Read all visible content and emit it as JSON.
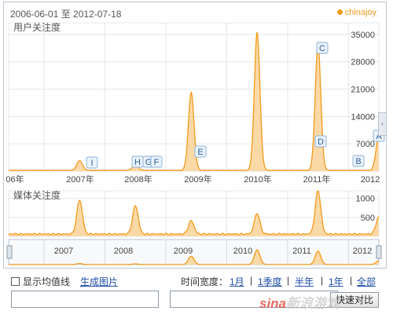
{
  "header": {
    "date_range": "2006-06-01 至 2012-07-18",
    "brand": "chinajoy"
  },
  "colors": {
    "line": "#f29a1c",
    "fill": "#fbd9a6",
    "marker_border": "#8fb3d9",
    "marker_bg": "#eaf2fb",
    "grid": "#e3e7ec"
  },
  "chart_data": [
    {
      "type": "area",
      "title": "用户关注度",
      "x_ticks": [
        "06年",
        "2007年",
        "2008年",
        "2009年",
        "2010年",
        "2011年",
        "2012"
      ],
      "y_ticks": [
        7000,
        14000,
        21000,
        28000,
        35000
      ],
      "ylim": [
        0,
        38000
      ],
      "peaks": [
        {
          "x": "2007-08",
          "y": 2500
        },
        {
          "x": "2008-07",
          "y": 1500
        },
        {
          "x": "2009-06",
          "y": 20000
        },
        {
          "x": "2010-07",
          "y": 35500
        },
        {
          "x": "2011-07",
          "y": 32500
        },
        {
          "x": "2012-07",
          "y": 9000
        }
      ],
      "markers": [
        {
          "label": "I",
          "x": "2007-09"
        },
        {
          "label": "H",
          "x": "2008-06"
        },
        {
          "label": "G",
          "x": "2008-08"
        },
        {
          "label": "F",
          "x": "2008-09"
        },
        {
          "label": "E",
          "x": "2009-06"
        },
        {
          "label": "D",
          "x": "2011-07"
        },
        {
          "label": "C",
          "x": "2011-07"
        },
        {
          "label": "B",
          "x": "2012-05"
        },
        {
          "label": "A",
          "x": "2012-07"
        }
      ]
    },
    {
      "type": "area",
      "title": "媒体关注度",
      "y_ticks": [
        500,
        1000
      ],
      "ylim": [
        0,
        1200
      ],
      "peaks": [
        {
          "x": "2007-08",
          "y": 900
        },
        {
          "x": "2008-07",
          "y": 750
        },
        {
          "x": "2009-06",
          "y": 350
        },
        {
          "x": "2010-07",
          "y": 550
        },
        {
          "x": "2011-07",
          "y": 1150
        },
        {
          "x": "2012-07",
          "y": 450
        }
      ]
    },
    {
      "type": "area",
      "title": "",
      "x_ticks": [
        "2007",
        "2008",
        "2009",
        "2010",
        "2011",
        "2012"
      ]
    }
  ],
  "controls": {
    "avg_label": "显示均值线",
    "gen_image": "生成图片",
    "time_span_label": "时间宽度：",
    "spans": [
      "1月",
      "1季度",
      "半年",
      "1年",
      "全部"
    ],
    "quick_compare": "快速对比"
  },
  "side_tab": "›",
  "watermark": {
    "sina": "sina",
    "rest": "新浪游戏"
  }
}
